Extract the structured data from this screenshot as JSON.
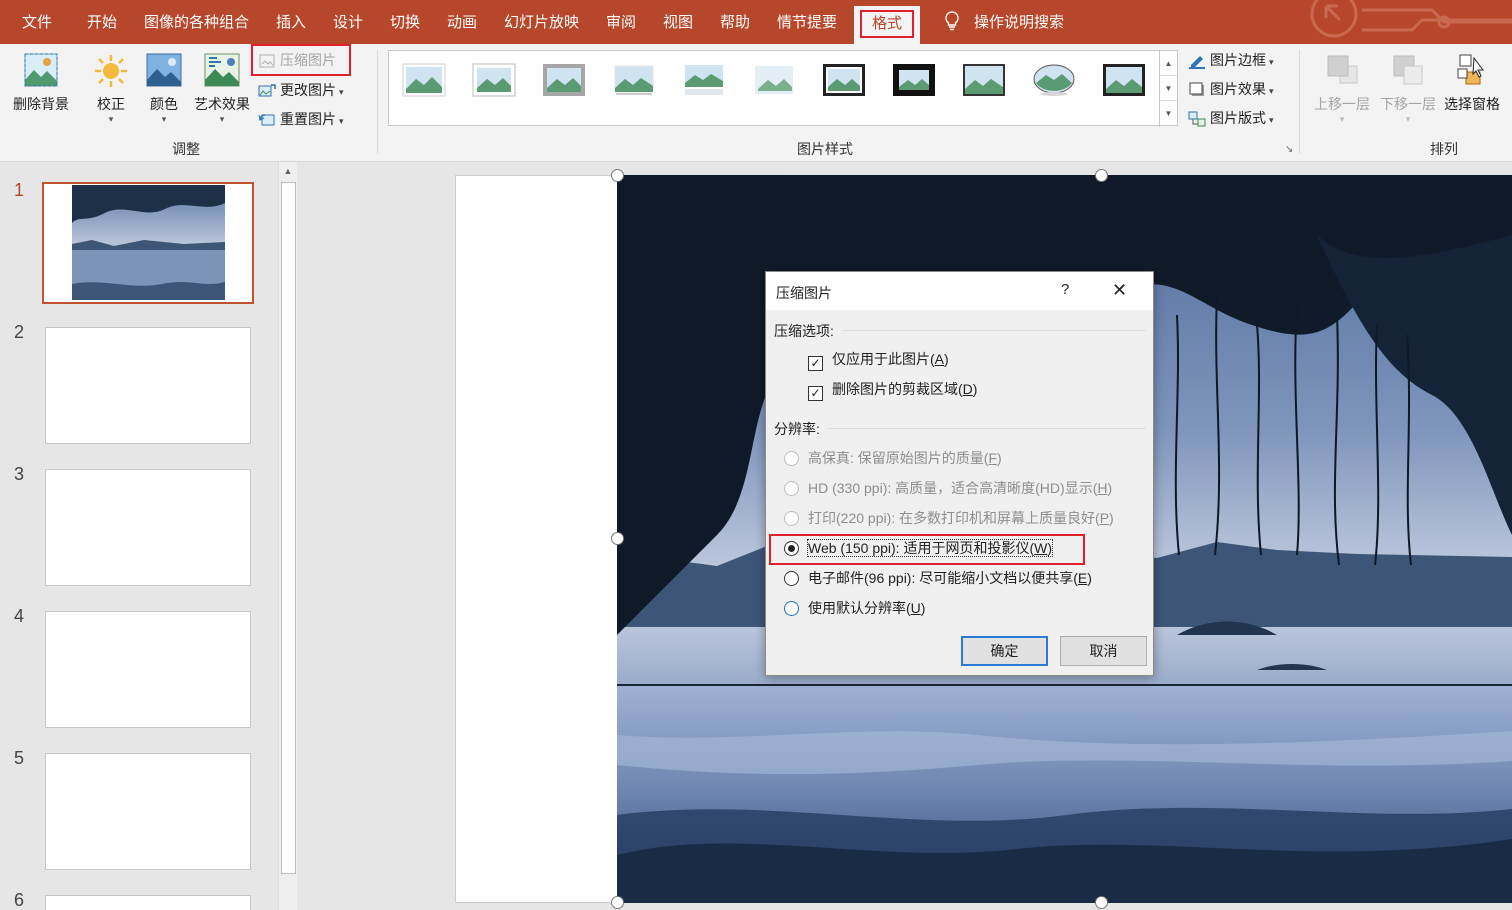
{
  "menu": {
    "tabs": [
      "文件",
      "开始",
      "图像的各种组合",
      "插入",
      "设计",
      "切换",
      "动画",
      "幻灯片放映",
      "审阅",
      "视图",
      "帮助",
      "情节提要"
    ],
    "active_tab": "格式",
    "tell_me": "操作说明搜索"
  },
  "ribbon": {
    "adjust": {
      "remove_bg": "删除背景",
      "correct": "校正",
      "color": "颜色",
      "artistic": "艺术效果",
      "compress": "压缩图片",
      "change": "更改图片",
      "reset": "重置图片",
      "group_label": "调整"
    },
    "styles": {
      "border": "图片边框",
      "effects": "图片效果",
      "layout": "图片版式",
      "group_label": "图片样式"
    },
    "arrange": {
      "bring_forward": "上移一层",
      "send_backward": "下移一层",
      "selection_pane": "选择窗格",
      "group_label": "排列"
    }
  },
  "slides": {
    "numbers": [
      "1",
      "2",
      "3",
      "4",
      "5",
      "6"
    ]
  },
  "dialog": {
    "title": "压缩图片",
    "help": "?",
    "close": "✕",
    "compress_section": "压缩选项:",
    "apply_only": "仅应用于此图片(",
    "apply_only_key": "A",
    "delete_crop": "删除图片的剪裁区域(",
    "delete_crop_key": "D",
    "resolution_section": "分辨率:",
    "res_hifi": "高保真: 保留原始图片的质量(",
    "res_hifi_key": "F",
    "res_hd": "HD (330 ppi): 高质量，适合高清晰度(HD)显示(",
    "res_hd_key": "H",
    "res_print": "打印(220 ppi): 在多数打印机和屏幕上质量良好(",
    "res_print_key": "P",
    "res_web": "Web (150 ppi): 适用于网页和投影仪(",
    "res_web_key": "W",
    "res_email": "电子邮件(96 ppi): 尽可能缩小文档以便共享(",
    "res_email_key": "E",
    "res_default": "使用默认分辨率(",
    "res_default_key": "U",
    "close_paren": ")",
    "ok": "确定",
    "cancel": "取消"
  }
}
